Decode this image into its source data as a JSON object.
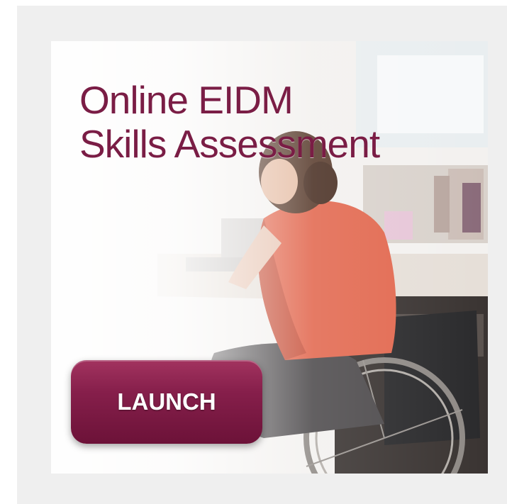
{
  "banner": {
    "title_line1": "Online EIDM",
    "title_line2": "Skills Assessment",
    "launch_label": "LAUNCH"
  },
  "colors": {
    "title": "#7a1d45",
    "button": "#861f4b",
    "background": "#efefef"
  },
  "photo": {
    "subject": "woman-in-wheelchair-at-desk"
  }
}
